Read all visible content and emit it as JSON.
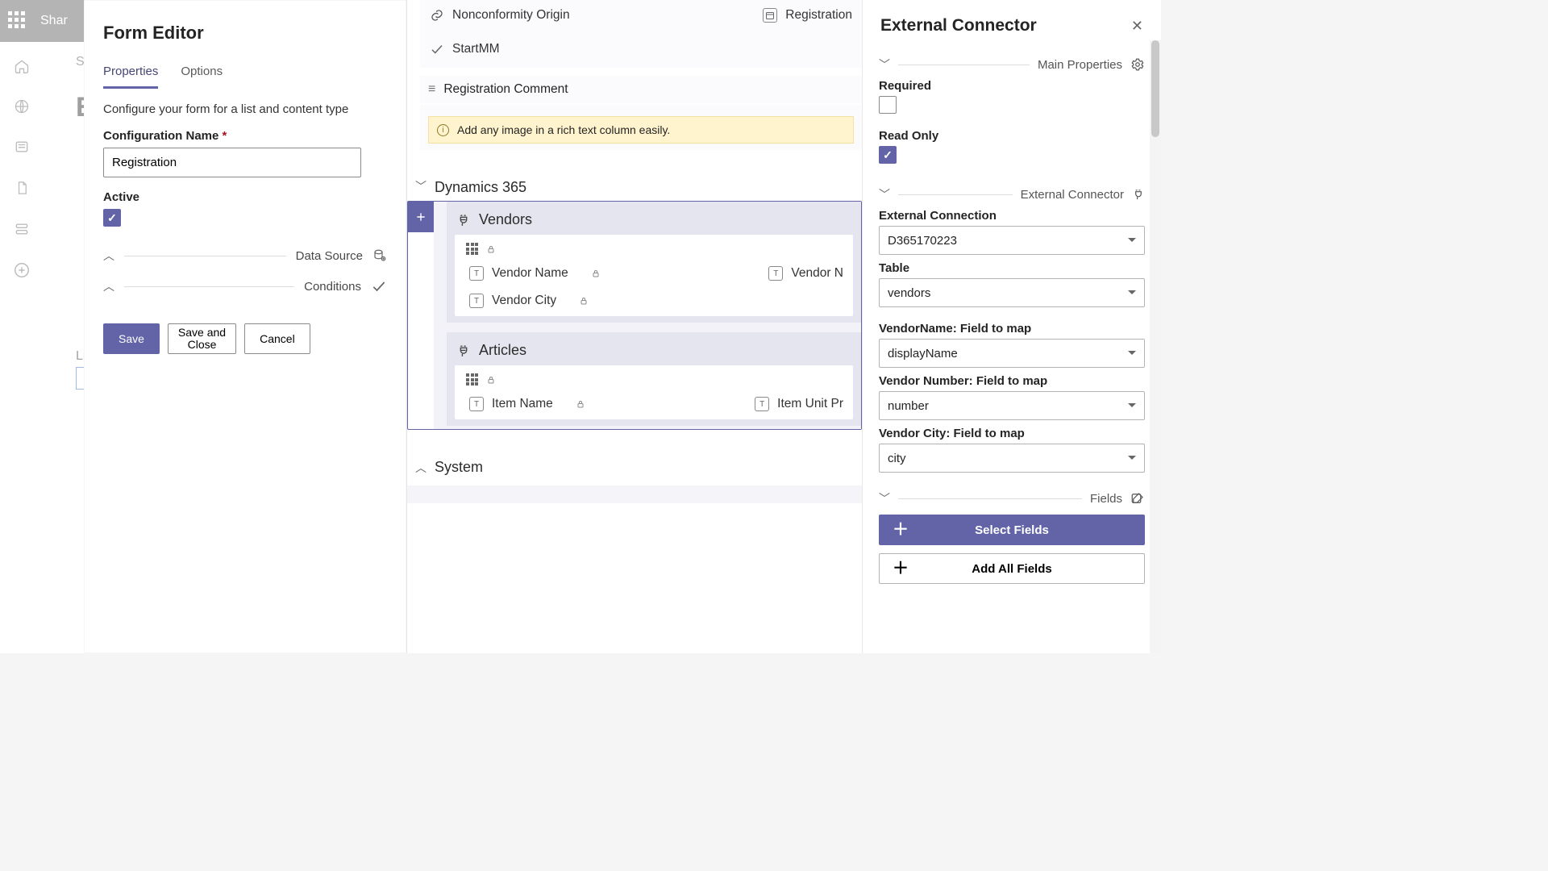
{
  "topbar": {
    "productName": "Shar"
  },
  "editor": {
    "title": "Form Editor",
    "tabs": [
      "Properties",
      "Options"
    ],
    "description": "Configure your form for a list and content type",
    "configNameLabel": "Configuration Name",
    "configNameValue": "Registration",
    "activeLabel": "Active",
    "section1": "Data Source",
    "section2": "Conditions",
    "buttons": {
      "save": "Save",
      "saveClose1": "Save and",
      "saveClose2": "Close",
      "cancel": "Cancel"
    }
  },
  "canvas": {
    "topFields": [
      "Nonconformity Origin",
      "Registration",
      "StartMM"
    ],
    "regComment": "Registration Comment",
    "tip": "Add any image in a rich text column easily.",
    "groups": [
      {
        "title": "Dynamics 365",
        "cards": [
          {
            "title": "Vendors",
            "fields": [
              "Vendor Name",
              "Vendor N",
              "Vendor City"
            ]
          },
          {
            "title": "Articles",
            "fields": [
              "Item Name",
              "Item Unit Pr"
            ]
          }
        ]
      },
      {
        "title": "System"
      }
    ]
  },
  "connector": {
    "title": "External Connector",
    "mainSection": "Main Properties",
    "requiredLabel": "Required",
    "readonlyLabel": "Read Only",
    "connectorSection": "External Connector",
    "externalConnectionLabel": "External Connection",
    "externalConnectionValue": "D365170223",
    "tableLabel": "Table",
    "tableValue": "vendors",
    "maps": [
      {
        "label": "VendorName: Field to map",
        "value": "displayName"
      },
      {
        "label": "Vendor Number: Field to map",
        "value": "number"
      },
      {
        "label": "Vendor City: Field to map",
        "value": "city"
      }
    ],
    "fieldsSection": "Fields",
    "selectFields": "Select Fields",
    "addAllFields": "Add All Fields"
  }
}
